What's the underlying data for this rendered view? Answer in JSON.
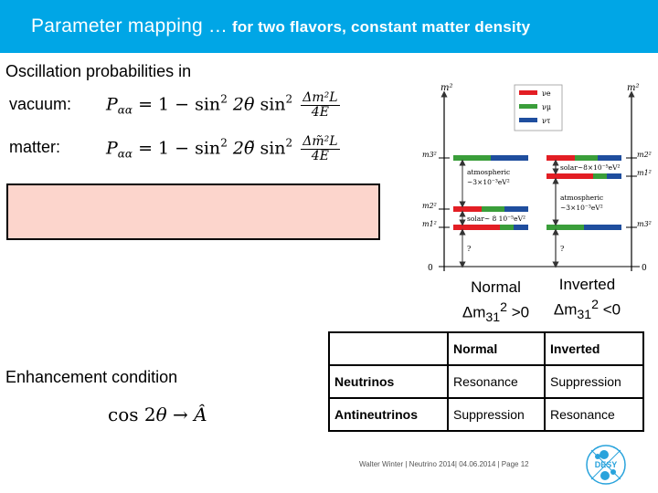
{
  "header": {
    "title_main": "Parameter mapping …",
    "title_sub": " for two flavors, constant matter density",
    "background_color": "#00a6e6"
  },
  "oscillation": {
    "heading": "Oscillation probabilities in",
    "vacuum_label": "vacuum:",
    "matter_label": "matter:",
    "vacuum_formula": {
      "lhs": "P",
      "lhs_sub": "αα",
      "rhs_prefix": "= 1 − sin",
      "sq": "2",
      "angle": "2θ",
      "sin2": "sin",
      "frac_num": "Δm²L",
      "frac_den": "4E"
    },
    "matter_formula": {
      "lhs": "P",
      "lhs_sub": "αα",
      "rhs_prefix": "= 1 − sin",
      "sq": "2",
      "angle": "2θ̃",
      "sin2": "sin",
      "frac_num": "Δm̃²L",
      "frac_den": "4E"
    }
  },
  "highlight_box": {
    "color": "#fcd5cc"
  },
  "mass_diagram": {
    "axis_label": "m²",
    "zero_label": "0",
    "legend": [
      {
        "name": "νe",
        "color": "#e31e24"
      },
      {
        "name": "νμ",
        "color": "#3a9e3a"
      },
      {
        "name": "ντ",
        "color": "#1f4e9e"
      }
    ],
    "normal": {
      "levels": [
        "m3²",
        "m2²",
        "m1²"
      ],
      "atmospheric": "atmospheric",
      "atmospheric_value": "~3×10⁻³eV²",
      "solar": "solar~ 8 10⁻⁵eV²",
      "unknown": "?"
    },
    "inverted": {
      "levels": [
        "m2²",
        "m1²",
        "m3²"
      ],
      "atmospheric": "atmospheric",
      "atmospheric_value": "~3×10⁻³eV²",
      "solar": "solar~8×10⁻⁵eV²",
      "unknown": "?"
    }
  },
  "captions": {
    "normal_title": "Normal",
    "normal_expr": "Δm",
    "normal_sub": "31",
    "normal_sup": "2",
    "normal_cond": " >0",
    "inverted_title": "Inverted",
    "inverted_expr": "Δm",
    "inverted_sub": "31",
    "inverted_sup": "2",
    "inverted_cond": " <0"
  },
  "enhancement": {
    "label": "Enhancement condition",
    "formula_cos": "cos 2",
    "formula_theta": "θ",
    "formula_arrow": " → ",
    "formula_A": "Â"
  },
  "table": {
    "headers": [
      "",
      "Normal",
      "Inverted"
    ],
    "rows": [
      [
        "Neutrinos",
        "Resonance",
        "Suppression"
      ],
      [
        "Antineutrinos",
        "Suppression",
        "Resonance"
      ]
    ]
  },
  "footer": {
    "text": "Walter Winter  | Neutrino 2014| 04.06.2014 | Page 12",
    "logo_text": "DESY",
    "logo_color": "#29a3dc"
  }
}
